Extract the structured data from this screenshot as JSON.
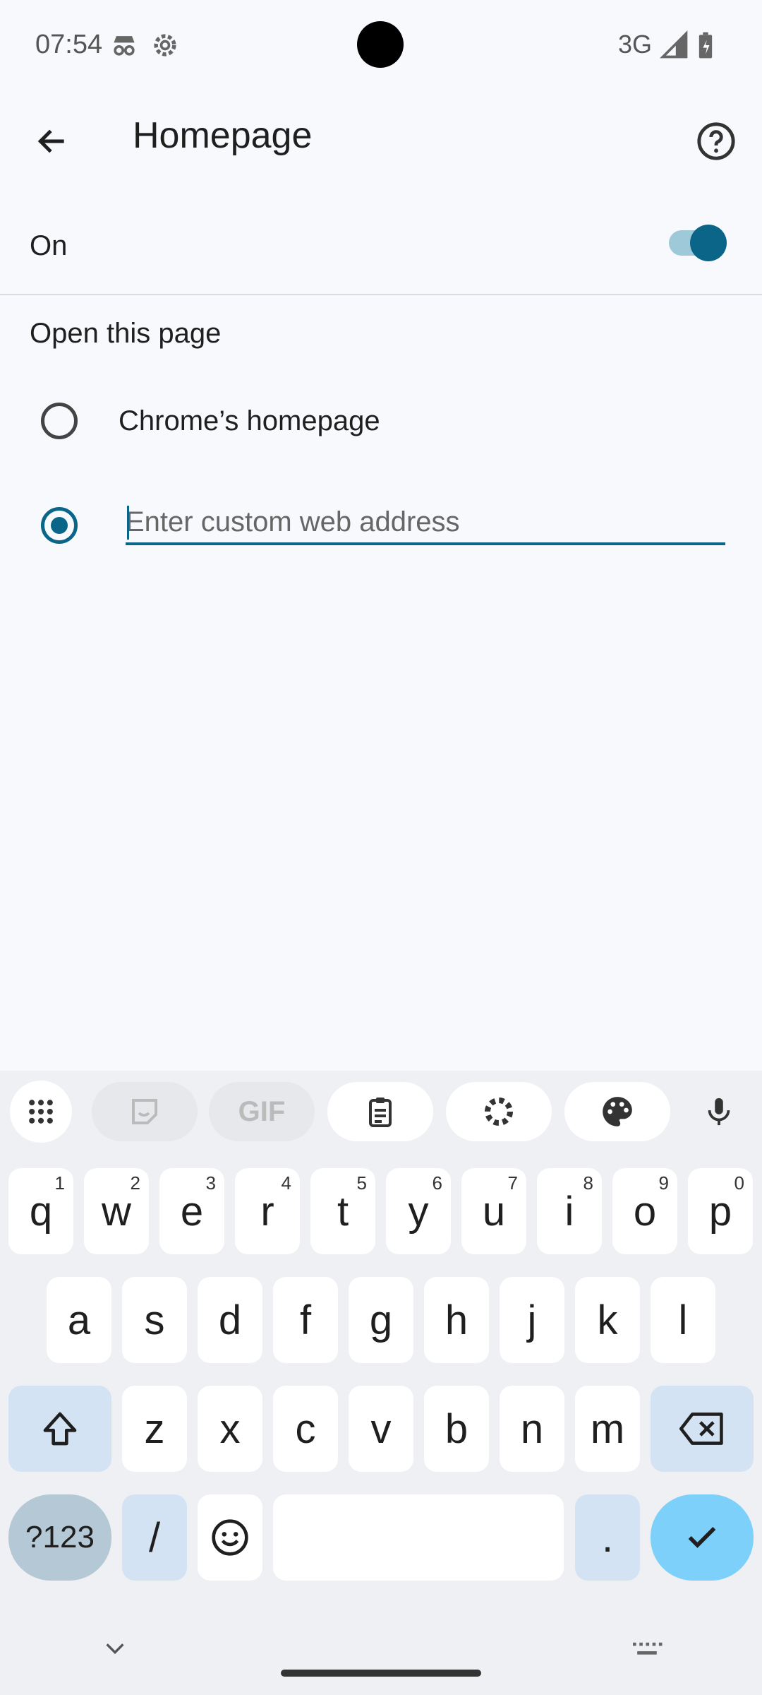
{
  "status_bar": {
    "time": "07:54",
    "network": "3G",
    "icons": [
      "incognito-icon",
      "settings-icon",
      "signal-icon",
      "battery-icon"
    ]
  },
  "app_bar": {
    "title": "Homepage",
    "back_icon": "arrow-left-icon",
    "help_icon": "help-circle-icon"
  },
  "toggle": {
    "label": "On",
    "state": "on"
  },
  "section": {
    "label": "Open this page"
  },
  "options": [
    {
      "label": "Chrome’s homepage",
      "selected": false
    },
    {
      "label": "",
      "selected": true
    }
  ],
  "url_field": {
    "value": "",
    "placeholder": "Enter custom web address"
  },
  "keyboard": {
    "toolbar": [
      "apps-icon",
      "sticker-icon",
      "GIF",
      "clipboard-icon",
      "settings-icon",
      "palette-icon",
      "mic-icon"
    ],
    "row1": [
      {
        "k": "q",
        "h": "1"
      },
      {
        "k": "w",
        "h": "2"
      },
      {
        "k": "e",
        "h": "3"
      },
      {
        "k": "r",
        "h": "4"
      },
      {
        "k": "t",
        "h": "5"
      },
      {
        "k": "y",
        "h": "6"
      },
      {
        "k": "u",
        "h": "7"
      },
      {
        "k": "i",
        "h": "8"
      },
      {
        "k": "o",
        "h": "9"
      },
      {
        "k": "p",
        "h": "0"
      }
    ],
    "row2": [
      "a",
      "s",
      "d",
      "f",
      "g",
      "h",
      "j",
      "k",
      "l"
    ],
    "row3": [
      "z",
      "x",
      "c",
      "v",
      "b",
      "n",
      "m"
    ],
    "sym_label": "?123",
    "slash_label": "/",
    "period_label": ".",
    "colors": {
      "accent": "#0a6588",
      "enter": "#7cd0f9",
      "modifier": "#d3e3f3"
    }
  }
}
